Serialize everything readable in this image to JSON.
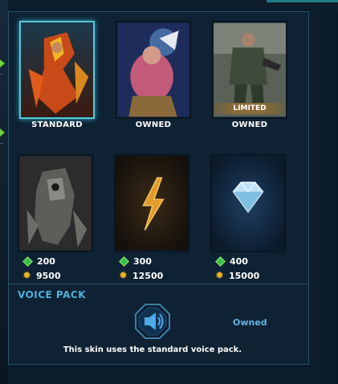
{
  "skins": [
    {
      "name": "standard-skin",
      "caption": "STANDARD",
      "selected": true
    },
    {
      "name": "skin-2",
      "caption": "OWNED",
      "selected": false
    },
    {
      "name": "skin-3",
      "caption": "OWNED",
      "banner": "LIMITED",
      "selected": false
    },
    {
      "name": "skin-4",
      "gems": "200",
      "favor": "9500"
    },
    {
      "name": "skin-5",
      "gems": "300",
      "favor": "12500"
    },
    {
      "name": "skin-6",
      "gems": "400",
      "favor": "15000"
    }
  ],
  "voice_pack": {
    "title": "VOICE PACK",
    "status": "Owned",
    "description": "This skin uses the standard voice pack."
  },
  "icons": {
    "gem": "gem-icon",
    "favor": "favor-icon",
    "speaker": "speaker-icon",
    "lightning": "lightning-icon",
    "diamond": "diamond-icon"
  },
  "colors": {
    "accent": "#57c6d9",
    "gem": "#39c04a",
    "favor": "#f2b625",
    "section_title": "#4fb0d8"
  }
}
